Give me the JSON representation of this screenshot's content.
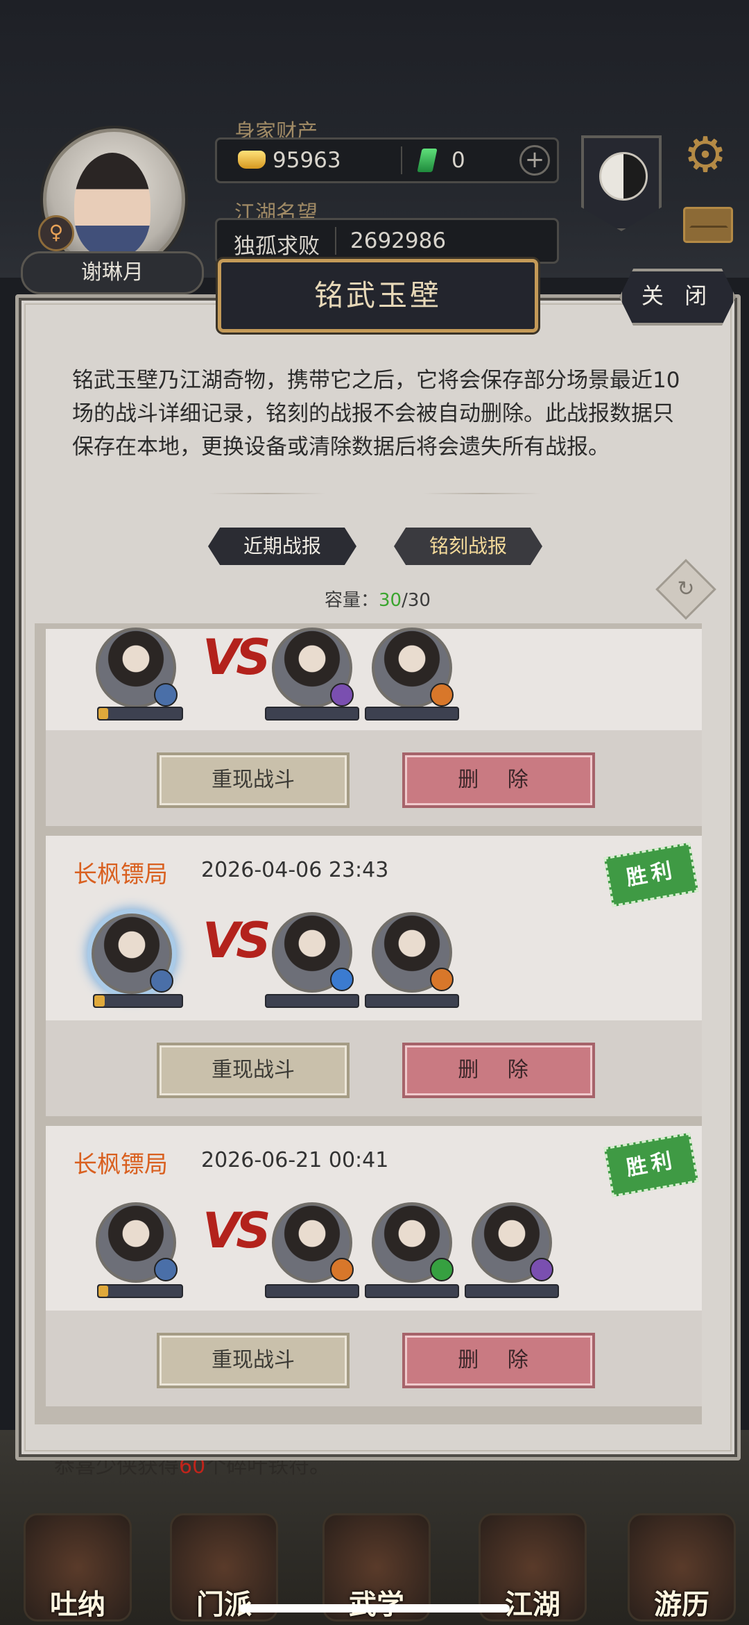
{
  "header": {
    "player_name": "谢琳月",
    "gender_symbol": "♀",
    "wealth_label": "身家财产",
    "gold": "95963",
    "jade": "0",
    "fame_label": "江湖名望",
    "fame_title": "独孤求败",
    "fame_value": "2692986"
  },
  "modal": {
    "title": "铭武玉壁",
    "close_label": "关 闭",
    "description": "铭武玉壁乃江湖奇物，携带它之后，它将会保存部分场景最近10场的战斗详细记录，铭刻的战报不会被自动删除。此战报数据只保存在本地，更换设备或清除数据后将会遗失所有战报。",
    "tabs": [
      {
        "label": "近期战报",
        "active": false
      },
      {
        "label": "铭刻战报",
        "active": true
      }
    ],
    "capacity_label": "容量：",
    "capacity_current": "30",
    "capacity_total": "/30",
    "vs_text": "VS",
    "replay_label": "重现战斗",
    "delete_label": "删 除",
    "records": [
      {
        "school": "",
        "time": "",
        "result": ""
      },
      {
        "school": "长枫镖局",
        "time": "2026-04-06 23:43",
        "result": "胜利"
      },
      {
        "school": "长枫镖局",
        "time": "2026-06-21 00:41",
        "result": "胜利"
      }
    ]
  },
  "ticker": {
    "prefix": "恭喜少侠获得",
    "amount": "60",
    "suffix": "个碎叶铁符。"
  },
  "nav": [
    {
      "label": "吐纳",
      "icon": "meditation-icon"
    },
    {
      "label": "门派",
      "icon": "sect-banner-icon"
    },
    {
      "label": "武学",
      "icon": "martial-book-icon"
    },
    {
      "label": "江湖",
      "icon": "bamboo-hat-icon"
    },
    {
      "label": "游历",
      "icon": "horse-icon"
    }
  ]
}
